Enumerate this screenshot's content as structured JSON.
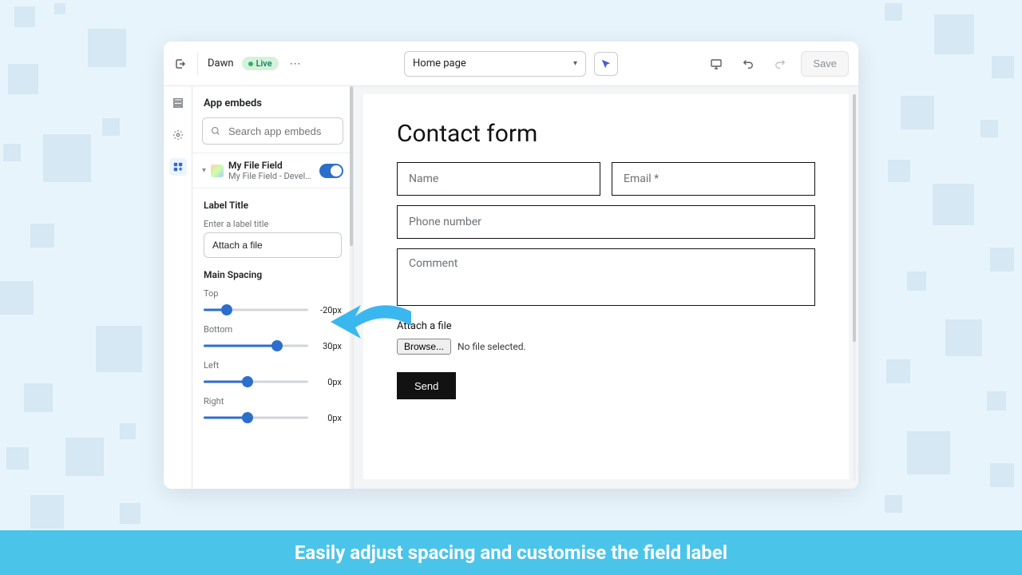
{
  "topbar": {
    "theme_name": "Dawn",
    "status": "Live",
    "page_select": "Home page",
    "save": "Save"
  },
  "sidebar": {
    "title": "App embeds",
    "search_placeholder": "Search app embeds",
    "app": {
      "name": "My File Field",
      "subtitle": "My File Field - Develop..."
    },
    "label_title_heading": "Label Title",
    "label_title_sub": "Enter a label title",
    "label_value": "Attach a file",
    "spacing_heading": "Main Spacing",
    "sliders": {
      "top": {
        "label": "Top",
        "value": "-20px",
        "pct": 22
      },
      "bottom": {
        "label": "Bottom",
        "value": "30px",
        "pct": 70
      },
      "left": {
        "label": "Left",
        "value": "0px",
        "pct": 42
      },
      "right": {
        "label": "Right",
        "value": "0px",
        "pct": 42
      }
    }
  },
  "form": {
    "title": "Contact form",
    "name": "Name",
    "email": "Email *",
    "phone": "Phone number",
    "comment": "Comment",
    "attach": "Attach a file",
    "browse": "Browse...",
    "no_file": "No file selected.",
    "send": "Send"
  },
  "banner": "Easily adjust spacing and customise the field label"
}
